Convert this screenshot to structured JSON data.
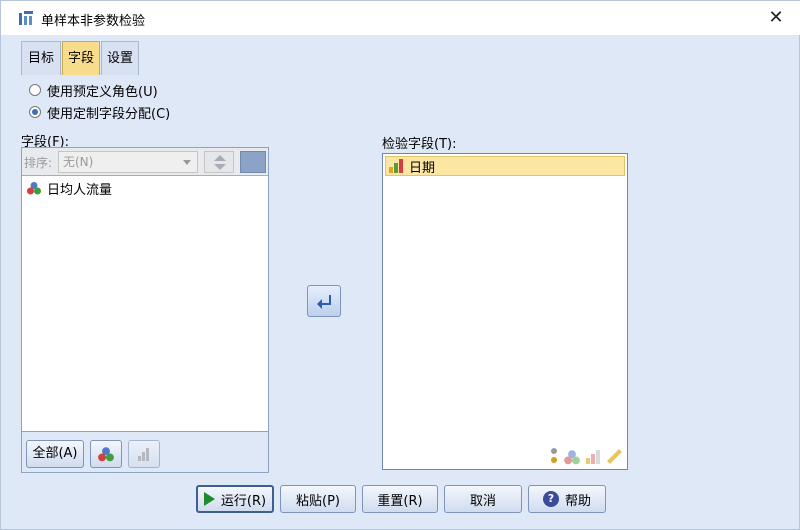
{
  "window": {
    "title": "单样本非参数检验",
    "close_symbol": "✕"
  },
  "tabs": [
    {
      "label": "目标"
    },
    {
      "label": "字段",
      "active": true
    },
    {
      "label": "设置"
    }
  ],
  "role_options": {
    "predefined": {
      "label": "使用预定义角色(U)",
      "selected": false
    },
    "custom": {
      "label": "使用定制字段分配(C)",
      "selected": true
    }
  },
  "fields_panel": {
    "label": "字段(F):",
    "sort_label": "排序:",
    "sort_value": "无(N)",
    "items": [
      {
        "label": "日均人流量",
        "icon": "nominal-measure-icon"
      }
    ],
    "all_button": "全部(A)"
  },
  "test_fields_panel": {
    "label": "检验字段(T):",
    "items": [
      {
        "label": "日期",
        "icon": "ordinal-measure-icon"
      }
    ]
  },
  "footer": {
    "run": "运行(R)",
    "paste": "粘贴(P)",
    "reset": "重置(R)",
    "cancel": "取消",
    "help": "帮助"
  },
  "colors": {
    "dialog_bg": "#dfe8f6",
    "active_tab": "#f7dc8c",
    "selected_item": "#fbe7a3",
    "run_icon": "#1d8b2a"
  }
}
